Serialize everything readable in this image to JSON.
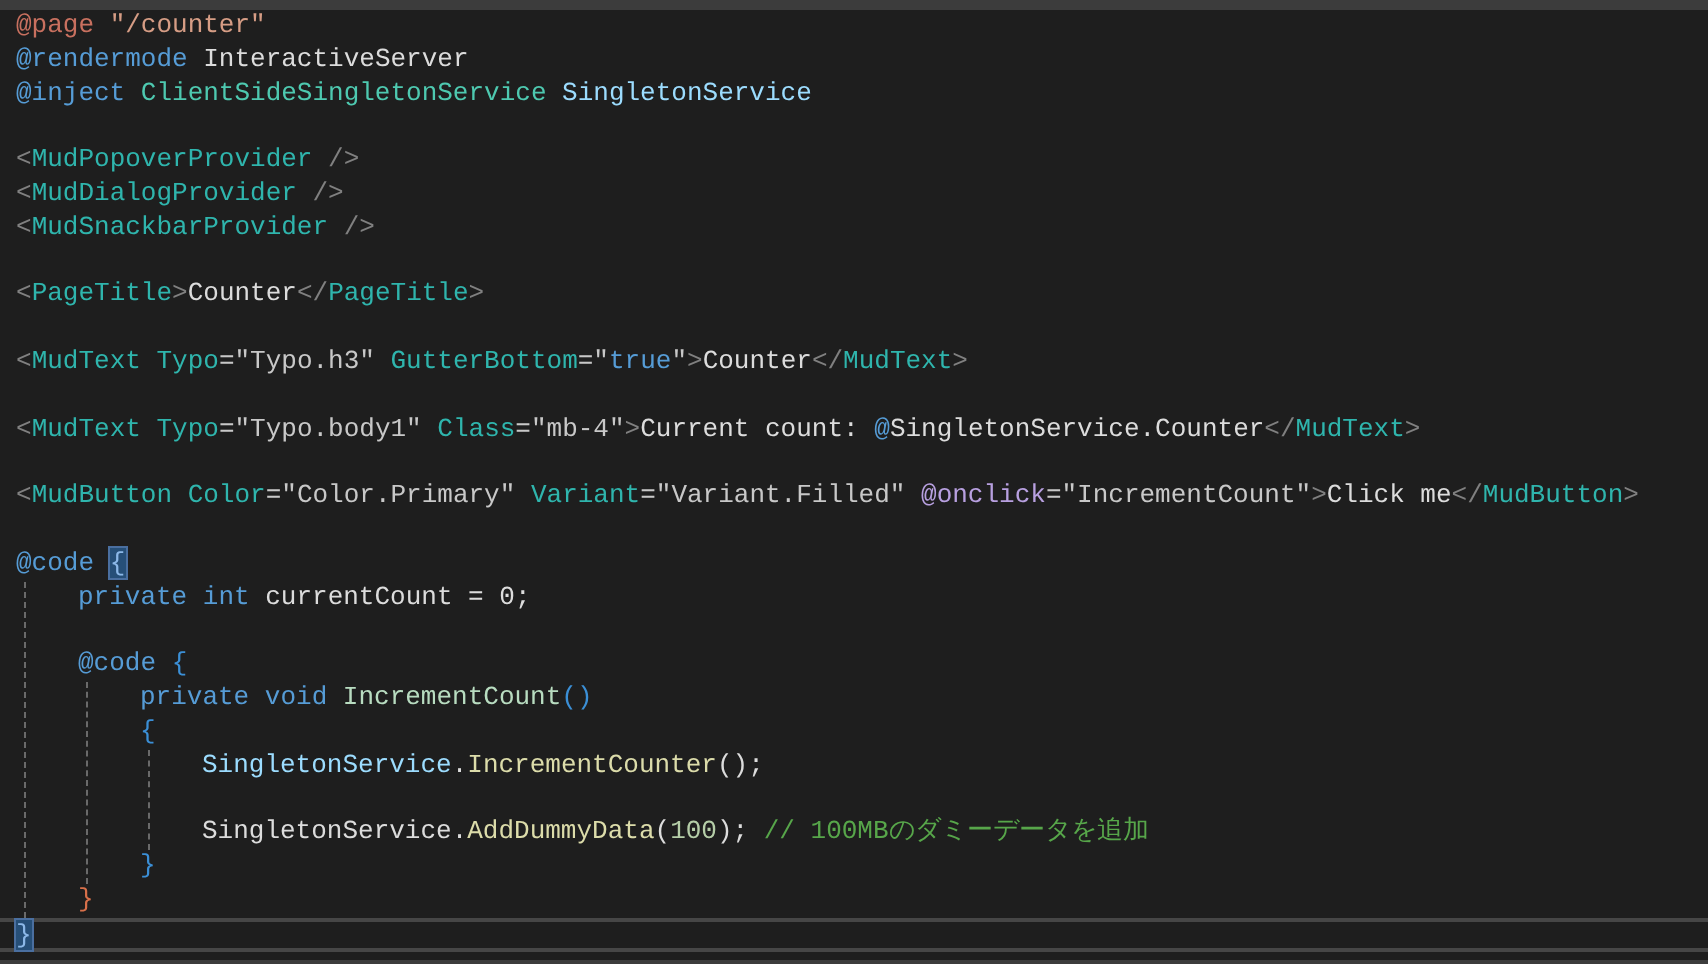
{
  "editor": {
    "paragraphs": [
      {
        "lines": [
          {
            "tokens": [
              {
                "text": "@page",
                "kind": "directive"
              },
              {
                "text": " \"/counter\"",
                "kind": "string"
              }
            ]
          },
          {
            "tokens": [
              {
                "text": "@rendermode",
                "kind": "razor"
              },
              {
                "text": " InteractiveServer",
                "kind": "plain"
              }
            ]
          },
          {
            "tokens": [
              {
                "text": "@inject",
                "kind": "razor"
              },
              {
                "text": " ClientSideSingletonService",
                "kind": "type"
              },
              {
                "text": " SingletonService",
                "kind": "variable"
              }
            ]
          }
        ]
      },
      {
        "lines": [
          {
            "tokens": [
              {
                "text": "<",
                "kind": "punct"
              },
              {
                "text": "MudPopoverProvider",
                "kind": "tag"
              },
              {
                "text": " />",
                "kind": "punct"
              }
            ]
          },
          {
            "tokens": [
              {
                "text": "<",
                "kind": "punct"
              },
              {
                "text": "MudDialogProvider",
                "kind": "tag"
              },
              {
                "text": " />",
                "kind": "punct"
              }
            ]
          },
          {
            "tokens": [
              {
                "text": "<",
                "kind": "punct"
              },
              {
                "text": "MudSnackbarProvider",
                "kind": "tag"
              },
              {
                "text": " />",
                "kind": "punct"
              }
            ]
          }
        ]
      },
      {
        "lines": [
          {
            "tokens": [
              {
                "text": "<",
                "kind": "punct"
              },
              {
                "text": "PageTitle",
                "kind": "tag"
              },
              {
                "text": ">",
                "kind": "punct"
              },
              {
                "text": "Counter",
                "kind": "plain"
              },
              {
                "text": "</",
                "kind": "punct"
              },
              {
                "text": "PageTitle",
                "kind": "tag"
              },
              {
                "text": ">",
                "kind": "punct"
              }
            ]
          }
        ]
      },
      {
        "lines": [
          {
            "tokens": [
              {
                "text": "<",
                "kind": "punct"
              },
              {
                "text": "MudText",
                "kind": "tag"
              },
              {
                "text": " Typo",
                "kind": "attr"
              },
              {
                "text": "=\"Typo.h3\"",
                "kind": "value"
              },
              {
                "text": " GutterBottom",
                "kind": "attr"
              },
              {
                "text": "=\"",
                "kind": "value"
              },
              {
                "text": "true",
                "kind": "razor"
              },
              {
                "text": "\"",
                "kind": "value"
              },
              {
                "text": ">",
                "kind": "punct"
              },
              {
                "text": "Counter",
                "kind": "plain"
              },
              {
                "text": "</",
                "kind": "punct"
              },
              {
                "text": "MudText",
                "kind": "tag"
              },
              {
                "text": ">",
                "kind": "punct"
              }
            ]
          }
        ]
      },
      {
        "lines": [
          {
            "tokens": [
              {
                "text": "<",
                "kind": "punct"
              },
              {
                "text": "MudText",
                "kind": "tag"
              },
              {
                "text": " Typo",
                "kind": "attr"
              },
              {
                "text": "=\"Typo.body1\"",
                "kind": "value"
              },
              {
                "text": " Class",
                "kind": "attr"
              },
              {
                "text": "=\"mb-4\"",
                "kind": "value"
              },
              {
                "text": ">",
                "kind": "punct"
              },
              {
                "text": "Current count: ",
                "kind": "plain"
              },
              {
                "text": "@",
                "kind": "razor"
              },
              {
                "text": "SingletonService.Counter",
                "kind": "plain"
              },
              {
                "text": "</",
                "kind": "punct"
              },
              {
                "text": "MudText",
                "kind": "tag"
              },
              {
                "text": ">",
                "kind": "punct"
              }
            ]
          }
        ]
      },
      {
        "lines": [
          {
            "tokens": [
              {
                "text": "<",
                "kind": "punct"
              },
              {
                "text": "MudButton",
                "kind": "tag"
              },
              {
                "text": " Color",
                "kind": "attr"
              },
              {
                "text": "=\"Color.Primary\"",
                "kind": "value"
              },
              {
                "text": " Variant",
                "kind": "attr"
              },
              {
                "text": "=\"Variant.Filled\"",
                "kind": "value"
              },
              {
                "text": " @onclick",
                "kind": "event"
              },
              {
                "text": "=\"IncrementCount\"",
                "kind": "value"
              },
              {
                "text": ">",
                "kind": "punct"
              },
              {
                "text": "Click me",
                "kind": "plain"
              },
              {
                "text": "</",
                "kind": "punct"
              },
              {
                "text": "MudButton",
                "kind": "tag"
              },
              {
                "text": ">",
                "kind": "punct"
              }
            ]
          }
        ]
      },
      {
        "lines": [
          {
            "tokens": [
              {
                "text": "@code ",
                "kind": "razor"
              },
              {
                "text": "{",
                "kind": "brace_match"
              }
            ],
            "children": [
              {
                "lines": [
                  {
                    "tokens": [
                      {
                        "text": "private int",
                        "kind": "keyword"
                      },
                      {
                        "text": " currentCount = 0;",
                        "kind": "plain"
                      }
                    ]
                  }
                ]
              },
              {
                "lines": [
                  {
                    "tokens": [
                      {
                        "text": "@code ",
                        "kind": "razor"
                      },
                      {
                        "text": "{",
                        "kind": "brace"
                      }
                    ],
                    "children": [
                      {
                        "lines": [
                          {
                            "tokens": [
                              {
                                "text": "private void",
                                "kind": "keyword"
                              },
                              {
                                "text": " IncrementCount",
                                "kind": "method_decl"
                              },
                              {
                                "text": "()",
                                "kind": "brace"
                              }
                            ]
                          },
                          {
                            "tokens": [
                              {
                                "text": "{",
                                "kind": "brace"
                              }
                            ],
                            "children": [
                              {
                                "lines": [
                                  {
                                    "tokens": [
                                      {
                                        "text": "SingletonService",
                                        "kind": "variable"
                                      },
                                      {
                                        "text": ".",
                                        "kind": "plain"
                                      },
                                      {
                                        "text": "IncrementCounter",
                                        "kind": "method"
                                      },
                                      {
                                        "text": "();",
                                        "kind": "plain"
                                      }
                                    ]
                                  }
                                ]
                              },
                              {
                                "lines": [
                                  {
                                    "tokens": [
                                      {
                                        "text": "SingletonService.",
                                        "kind": "plain"
                                      },
                                      {
                                        "text": "AddDummyData",
                                        "kind": "method"
                                      },
                                      {
                                        "text": "(",
                                        "kind": "plain"
                                      },
                                      {
                                        "text": "100",
                                        "kind": "number"
                                      },
                                      {
                                        "text": "); ",
                                        "kind": "plain"
                                      },
                                      {
                                        "text": "// 100MBのダミーデータを追加",
                                        "kind": "comment"
                                      }
                                    ]
                                  }
                                ]
                              }
                            ]
                          },
                          {
                            "tokens": [
                              {
                                "text": "}",
                                "kind": "brace"
                              }
                            ]
                          }
                        ]
                      }
                    ]
                  },
                  {
                    "tokens": [
                      {
                        "text": "}",
                        "kind": "brace_outer"
                      }
                    ]
                  }
                ]
              }
            ]
          },
          {
            "tokens": [
              {
                "text": "}",
                "kind": "brace_match"
              }
            ],
            "current": true
          }
        ]
      }
    ]
  }
}
